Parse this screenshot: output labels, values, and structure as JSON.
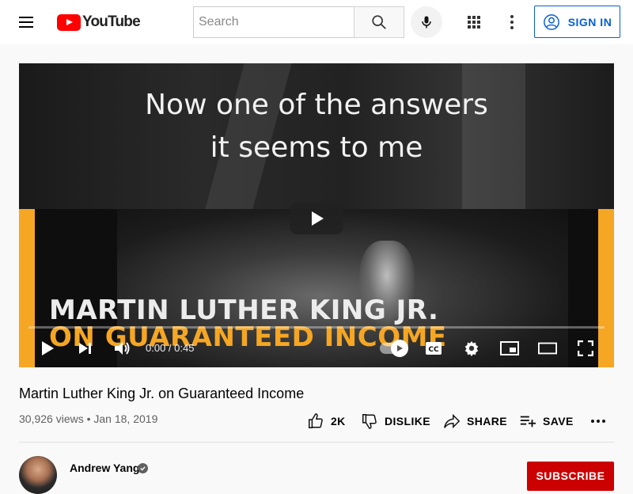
{
  "header": {
    "logo_text": "YouTube",
    "search_placeholder": "Search",
    "signin_label": "SIGN IN"
  },
  "player": {
    "caption_line_1": "Now one of the answers",
    "caption_line_2": "it seems to me",
    "title_overlay_1": "MARTIN LUTHER KING JR.",
    "title_overlay_2": "ON GUARANTEED INCOME",
    "time_display": "0:00 / 0:45",
    "progress": 0,
    "accent_color": "#f5a623"
  },
  "video": {
    "title": "Martin Luther King Jr. on Guaranteed Income",
    "views_and_date": "30,926 views • Jan 18, 2019",
    "like_count": "2K",
    "dislike_label": "DISLIKE",
    "share_label": "SHARE",
    "save_label": "SAVE"
  },
  "channel": {
    "name": "Andrew Yang",
    "subscribe_label": "SUBSCRIBE",
    "subscribe_color": "#cc0000"
  },
  "icons": [
    "menu-icon",
    "youtube-logo",
    "search-icon",
    "mic-icon",
    "apps-icon",
    "more-vert-icon",
    "account-icon",
    "play-icon",
    "next-icon",
    "volume-icon",
    "cc-icon",
    "settings-icon",
    "miniplayer-icon",
    "theater-icon",
    "fullscreen-icon",
    "like-icon",
    "dislike-icon",
    "share-icon",
    "save-icon",
    "more-horiz-icon",
    "verified-icon"
  ]
}
